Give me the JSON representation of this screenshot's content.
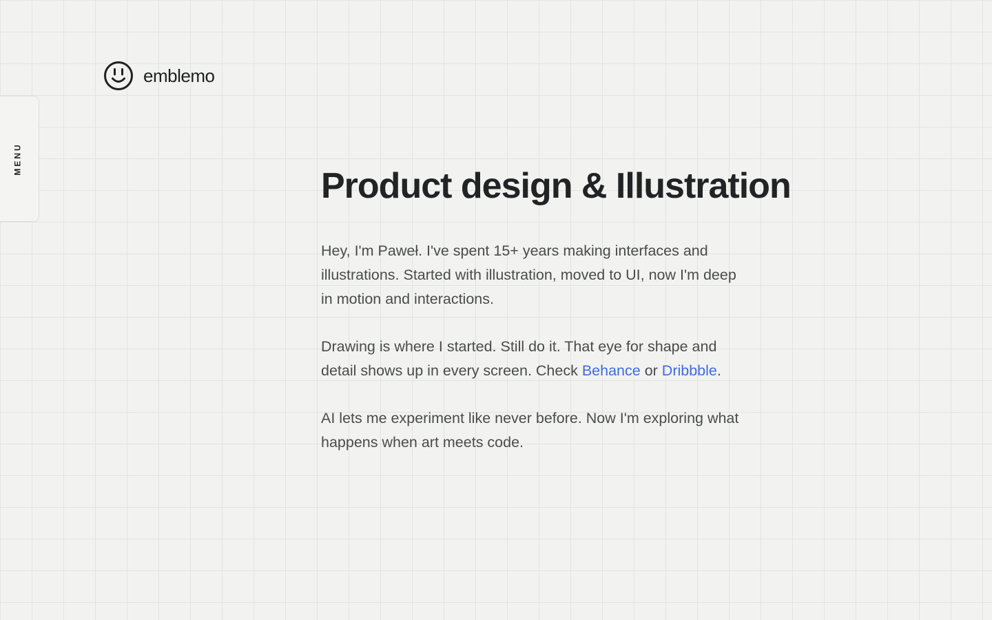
{
  "header": {
    "logo_text": "emblemo",
    "logo_icon": "smiley-face-icon"
  },
  "menu": {
    "label": "MENU"
  },
  "main": {
    "title": "Product design & Illustration",
    "paragraph1": "Hey, I'm Paweł. I've spent 15+ years making interfaces and illustrations. Started with illustration, moved to UI, now I'm deep in motion and interactions.",
    "paragraph2": {
      "text_before": "Drawing is where I started. Still do it. That eye for shape and detail shows up in every screen. Check ",
      "link_behance": "Behance",
      "text_middle": " or ",
      "link_dribbble": "Dribbble",
      "text_after": "."
    },
    "paragraph3": "AI lets me experiment like never before. Now I'm exploring what happens when art meets code."
  },
  "colors": {
    "background": "#f2f2f0",
    "grid_line": "#e3e3e1",
    "text_heading": "#222325",
    "text_body": "#4a4b4e",
    "link": "#3f6bde"
  }
}
